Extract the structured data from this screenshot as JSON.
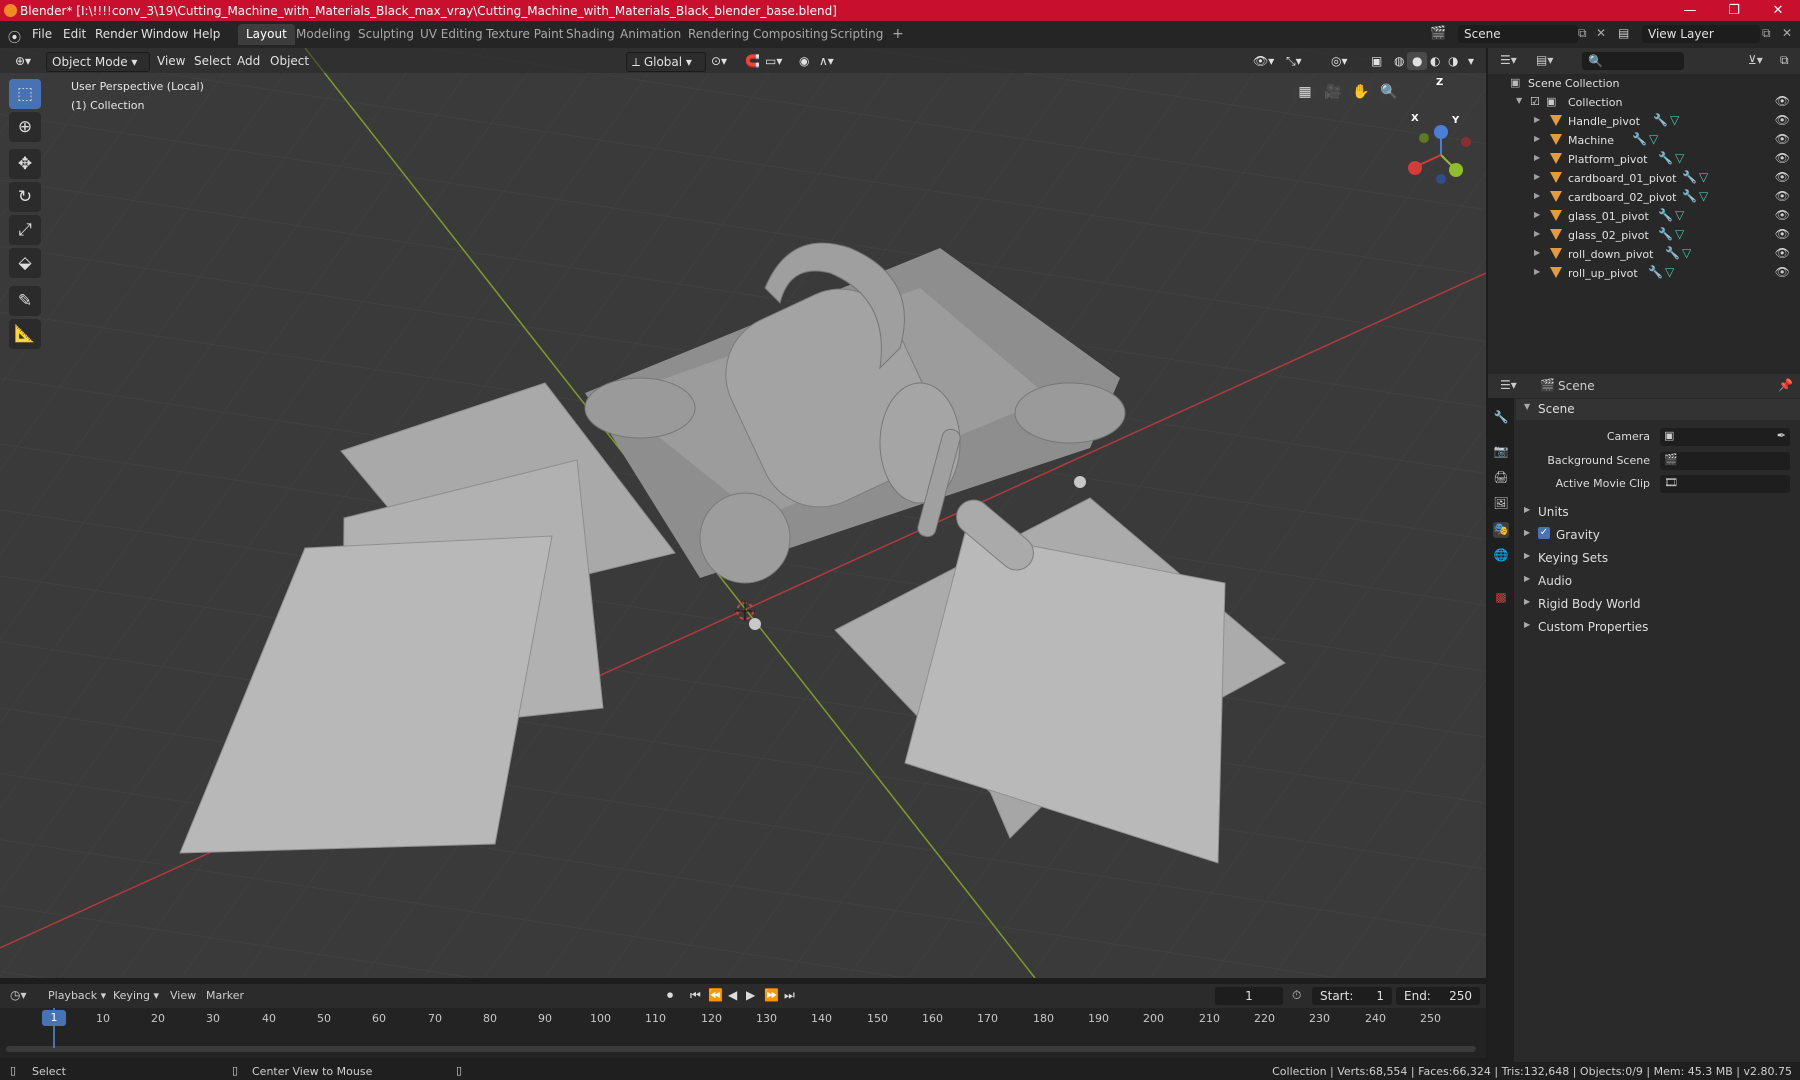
{
  "title_bar": {
    "title": "Blender* [I:\\!!!!conv_3\\19\\Cutting_Machine_with_Materials_Black_max_vray\\Cutting_Machine_with_Materials_Black_blender_base.blend]",
    "minimize": "—",
    "maximize": "❐",
    "close": "✕"
  },
  "menu": [
    "File",
    "Edit",
    "Render",
    "Window",
    "Help"
  ],
  "workspaces": [
    "Layout",
    "Modeling",
    "Sculpting",
    "UV Editing",
    "Texture Paint",
    "Shading",
    "Animation",
    "Rendering",
    "Compositing",
    "Scripting"
  ],
  "workspace_add": "+",
  "scene_field": "Scene",
  "view_layer_field": "View Layer",
  "viewport": {
    "mode": "Object Mode",
    "menus": [
      "View",
      "Select",
      "Add",
      "Object"
    ],
    "transform": "Global",
    "info_line1": "User Perspective (Local)",
    "info_line2": "(1) Collection",
    "gizmo": {
      "x": "X",
      "y": "Y",
      "z": "Z"
    }
  },
  "outliner": {
    "search_placeholder": "",
    "root": "Scene Collection",
    "collection": "Collection",
    "items": [
      "Handle_pivot",
      "Machine",
      "Platform_pivot",
      "cardboard_01_pivot",
      "cardboard_02_pivot",
      "glass_01_pivot",
      "glass_02_pivot",
      "roll_down_pivot",
      "roll_up_pivot"
    ]
  },
  "properties": {
    "context": "Scene",
    "panel": "Scene",
    "camera_label": "Camera",
    "background_scene_label": "Background Scene",
    "active_movie_clip_label": "Active Movie Clip",
    "sections": [
      "Units",
      "Gravity",
      "Keying Sets",
      "Audio",
      "Rigid Body World",
      "Custom Properties"
    ],
    "gravity_checked": true
  },
  "timeline": {
    "menus": [
      "Playback",
      "Keying",
      "View",
      "Marker"
    ],
    "current_frame": "1",
    "start_label": "Start:",
    "start": "1",
    "end_label": "End:",
    "end": "250",
    "ticks": [
      "1",
      "10",
      "20",
      "30",
      "40",
      "50",
      "60",
      "70",
      "80",
      "90",
      "100",
      "110",
      "120",
      "130",
      "140",
      "150",
      "160",
      "170",
      "180",
      "190",
      "200",
      "210",
      "220",
      "230",
      "240",
      "250"
    ]
  },
  "status": {
    "select": "Select",
    "center_view": "Center View to Mouse",
    "stats": "Collection | Verts:68,554 | Faces:66,324 | Tris:132,648 | Objects:0/9 | Mem: 45.3 MB | v2.80.75"
  },
  "colors": {
    "title_bar": "#c8102e",
    "accent": "#4772b3",
    "object_icon": "#e59a3b",
    "x_axis": "#d63b3b",
    "y_axis": "#8fbd2c"
  }
}
